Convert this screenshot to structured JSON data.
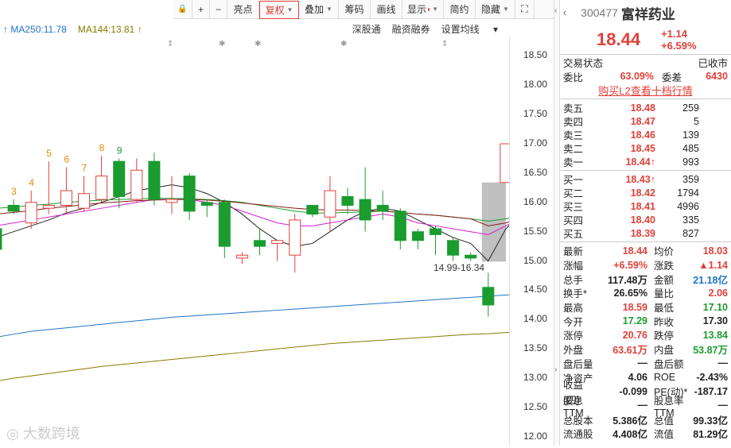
{
  "toolbar": {
    "items": [
      {
        "label": "",
        "icon": "lock-icon"
      },
      {
        "label": "+"
      },
      {
        "label": "−"
      },
      {
        "label": "亮点"
      },
      {
        "label": "复权",
        "dropdown": true,
        "active": true
      },
      {
        "label": "叠加",
        "dropdown": true
      },
      {
        "label": "筹码"
      },
      {
        "label": "画线"
      },
      {
        "label": "显示",
        "dropdown": true,
        "dot": true
      },
      {
        "label": "简约"
      },
      {
        "label": "隐藏",
        "dropdown": true
      },
      {
        "label": "",
        "icon": "fullscreen-icon"
      }
    ]
  },
  "ma": [
    {
      "label": "MA250:11.78",
      "color": "#1f74c7"
    },
    {
      "label": "MA144:13.81",
      "color": "#8a7a00"
    }
  ],
  "chart_links": [
    "深股通",
    "融资融券",
    "设置均线"
  ],
  "chart": {
    "ytick_labels": [
      "18.50",
      "18.00",
      "17.50",
      "17.00",
      "16.50",
      "16.00",
      "15.50",
      "15.00",
      "14.50",
      "14.00",
      "13.50",
      "13.00",
      "12.50",
      "12.00"
    ],
    "range_label": "14.99-16.34",
    "seq_labels": [
      "3",
      "4",
      "5",
      "6",
      "7",
      "8",
      "9"
    ],
    "colors": {
      "up": "#e0413a",
      "down": "#1b9c2f"
    }
  },
  "chart_data": {
    "type": "candlestick",
    "ylim": [
      11.85,
      18.83
    ],
    "candles": [
      {
        "o": 15.55,
        "h": 15.9,
        "l": 15.05,
        "c": 15.2
      },
      {
        "o": 15.95,
        "h": 16.05,
        "l": 15.8,
        "c": 15.85
      },
      {
        "o": 15.65,
        "h": 16.2,
        "l": 15.55,
        "c": 16.0
      },
      {
        "o": 15.9,
        "h": 16.7,
        "l": 15.8,
        "c": 15.95
      },
      {
        "o": 15.95,
        "h": 16.6,
        "l": 15.8,
        "c": 16.2
      },
      {
        "o": 15.9,
        "h": 16.45,
        "l": 15.85,
        "c": 16.15
      },
      {
        "o": 16.05,
        "h": 16.8,
        "l": 16.0,
        "c": 16.45
      },
      {
        "o": 16.7,
        "h": 16.75,
        "l": 15.9,
        "c": 16.1
      },
      {
        "o": 16.05,
        "h": 16.75,
        "l": 16.0,
        "c": 16.55
      },
      {
        "o": 16.7,
        "h": 16.85,
        "l": 15.95,
        "c": 16.05
      },
      {
        "o": 16.0,
        "h": 16.45,
        "l": 15.8,
        "c": 16.05
      },
      {
        "o": 16.45,
        "h": 16.5,
        "l": 15.7,
        "c": 15.85
      },
      {
        "o": 16.0,
        "h": 16.05,
        "l": 15.75,
        "c": 15.95
      },
      {
        "o": 16.0,
        "h": 16.05,
        "l": 15.05,
        "c": 15.25
      },
      {
        "o": 15.05,
        "h": 15.15,
        "l": 14.95,
        "c": 15.1
      },
      {
        "o": 15.35,
        "h": 15.55,
        "l": 15.1,
        "c": 15.25
      },
      {
        "o": 15.3,
        "h": 15.35,
        "l": 15.0,
        "c": 15.35
      },
      {
        "o": 15.1,
        "h": 15.8,
        "l": 14.8,
        "c": 15.7
      },
      {
        "o": 15.95,
        "h": 15.95,
        "l": 15.75,
        "c": 15.8
      },
      {
        "o": 15.75,
        "h": 16.45,
        "l": 15.5,
        "c": 16.2
      },
      {
        "o": 16.1,
        "h": 16.25,
        "l": 15.8,
        "c": 15.95
      },
      {
        "o": 16.05,
        "h": 16.6,
        "l": 15.5,
        "c": 15.7
      },
      {
        "o": 15.95,
        "h": 16.2,
        "l": 15.7,
        "c": 15.85
      },
      {
        "o": 15.85,
        "h": 15.9,
        "l": 15.2,
        "c": 15.35
      },
      {
        "o": 15.5,
        "h": 15.55,
        "l": 15.2,
        "c": 15.35
      },
      {
        "o": 15.55,
        "h": 15.6,
        "l": 15.1,
        "c": 15.45
      },
      {
        "o": 15.35,
        "h": 15.4,
        "l": 15.0,
        "c": 15.1
      },
      {
        "o": 15.1,
        "h": 15.15,
        "l": 15.0,
        "c": 15.05
      },
      {
        "o": 14.55,
        "h": 14.8,
        "l": 14.05,
        "c": 14.25
      },
      {
        "o": 16.34,
        "h": 17.0,
        "l": 16.34,
        "c": 17.0
      },
      {
        "o": 17.0,
        "h": 17.45,
        "l": 16.9,
        "c": 17.35
      },
      {
        "o": 17.3,
        "h": 18.59,
        "l": 17.1,
        "c": 18.44
      }
    ],
    "ma_lines": [
      {
        "color": "#222",
        "values": [
          15.4,
          15.5,
          15.6,
          15.7,
          15.82,
          15.9,
          16.0,
          16.1,
          16.2,
          16.25,
          16.3,
          16.25,
          16.15,
          16.0,
          15.8,
          15.55,
          15.35,
          15.25,
          15.3,
          15.5,
          15.7,
          15.85,
          15.9,
          15.85,
          15.7,
          15.55,
          15.4,
          15.3,
          15.0,
          15.55,
          15.85,
          16.3
        ]
      },
      {
        "color": "#d020d0",
        "values": [
          15.6,
          15.65,
          15.7,
          15.75,
          15.8,
          15.85,
          15.9,
          15.95,
          16.0,
          16.05,
          16.05,
          16.05,
          16.0,
          15.95,
          15.85,
          15.75,
          15.65,
          15.6,
          15.6,
          15.65,
          15.7,
          15.75,
          15.8,
          15.75,
          15.65,
          15.6,
          15.55,
          15.5,
          15.45,
          15.6,
          15.75,
          15.9
        ]
      },
      {
        "color": "#1b9c2f",
        "values": [
          15.9,
          15.92,
          15.95,
          15.97,
          16.0,
          16.02,
          16.04,
          16.05,
          16.06,
          16.07,
          16.07,
          16.06,
          16.05,
          16.03,
          16.0,
          15.95,
          15.9,
          15.85,
          15.82,
          15.82,
          15.83,
          15.84,
          15.85,
          15.83,
          15.8,
          15.78,
          15.75,
          15.72,
          15.68,
          15.72,
          15.8,
          15.92
        ]
      },
      {
        "color": "#8b1a1a",
        "values": [
          15.8,
          15.83,
          15.86,
          15.9,
          15.93,
          15.96,
          15.99,
          16.01,
          16.03,
          16.04,
          16.05,
          16.05,
          16.04,
          16.02,
          15.99,
          15.96,
          15.93,
          15.9,
          15.88,
          15.87,
          15.87,
          15.86,
          15.85,
          15.83,
          15.8,
          15.78,
          15.75,
          15.72,
          15.6,
          15.65,
          15.75,
          15.86
        ]
      },
      {
        "color": "#1f74c7",
        "values": [
          13.7,
          13.75,
          13.8,
          13.83,
          13.86,
          13.89,
          13.92,
          13.95,
          13.98,
          14.01,
          14.04,
          14.06,
          14.08,
          14.1,
          14.12,
          14.14,
          14.16,
          14.18,
          14.2,
          14.22,
          14.24,
          14.26,
          14.28,
          14.3,
          14.32,
          14.34,
          14.36,
          14.38,
          14.4,
          14.42,
          14.44,
          14.5
        ]
      },
      {
        "color": "#8a7a00",
        "values": [
          12.95,
          13.0,
          13.04,
          13.08,
          13.12,
          13.16,
          13.2,
          13.23,
          13.26,
          13.29,
          13.32,
          13.35,
          13.38,
          13.41,
          13.44,
          13.47,
          13.5,
          13.53,
          13.56,
          13.59,
          13.61,
          13.63,
          13.65,
          13.67,
          13.69,
          13.71,
          13.73,
          13.75,
          13.76,
          13.78,
          13.8,
          13.84
        ]
      }
    ]
  },
  "quote": {
    "code": "300477",
    "name": "富祥药业",
    "price": "18.44",
    "change": "+1.14",
    "change_pct": "+6.59%",
    "status_label": "交易状态",
    "status_value": "已收市",
    "wb_label": "委比",
    "wb_value": "63.09%",
    "wc_label": "委差",
    "wc_value": "6430",
    "buy_l2": "购买L2查看十档行情"
  },
  "asks": [
    {
      "label": "卖五",
      "price": "18.48",
      "vol": "259"
    },
    {
      "label": "卖四",
      "price": "18.47",
      "vol": "5"
    },
    {
      "label": "卖三",
      "price": "18.46",
      "vol": "139"
    },
    {
      "label": "卖二",
      "price": "18.45",
      "vol": "485"
    },
    {
      "label": "卖一",
      "price": "18.44↑",
      "vol": "993"
    }
  ],
  "bids": [
    {
      "label": "买一",
      "price": "18.43↑",
      "vol": "359"
    },
    {
      "label": "买二",
      "price": "18.42",
      "vol": "1794"
    },
    {
      "label": "买三",
      "price": "18.41",
      "vol": "4996"
    },
    {
      "label": "买四",
      "price": "18.40",
      "vol": "335"
    },
    {
      "label": "买五",
      "price": "18.39",
      "vol": "827"
    }
  ],
  "stats": [
    {
      "k1": "最新",
      "v1": "18.44",
      "c1": "red",
      "k2": "均价",
      "v2": "18.03",
      "c2": "red"
    },
    {
      "k1": "涨幅",
      "v1": "+6.59%",
      "c1": "red",
      "k2": "涨跌",
      "v2": "▲1.14",
      "c2": "red"
    },
    {
      "k1": "总手",
      "v1": "117.48万",
      "c1": "",
      "k2": "金额",
      "v2": "21.18亿",
      "c2": "blue"
    },
    {
      "k1": "换手*",
      "v1": "26.65%",
      "c1": "",
      "k2": "量比",
      "v2": "2.06",
      "c2": "red"
    },
    {
      "k1": "最高",
      "v1": "18.59",
      "c1": "red",
      "k2": "最低",
      "v2": "17.10",
      "c2": "green"
    },
    {
      "k1": "今开",
      "v1": "17.29",
      "c1": "green",
      "k2": "昨收",
      "v2": "17.30",
      "c2": ""
    },
    {
      "k1": "涨停",
      "v1": "20.76",
      "c1": "red",
      "k2": "跌停",
      "v2": "13.84",
      "c2": "green"
    },
    {
      "k1": "外盘",
      "v1": "63.61万",
      "c1": "red",
      "k2": "内盘",
      "v2": "53.87万",
      "c2": "green"
    },
    {
      "k1": "盘后量",
      "v1": "—",
      "c1": "",
      "k2": "盘后额",
      "v2": "—",
      "c2": ""
    },
    {
      "k1": "净资产",
      "v1": "4.06",
      "c1": "",
      "k2": "ROE",
      "v2": "-2.43%",
      "c2": ""
    },
    {
      "k1": "收益(四)",
      "v1": "-0.099",
      "c1": "",
      "k2": "PE(动)*",
      "v2": "-187.17",
      "c2": ""
    },
    {
      "k1": "股息TTM",
      "v1": "—",
      "c1": "",
      "k2": "股息率TTM",
      "v2": "—",
      "c2": ""
    },
    {
      "k1": "总股本",
      "v1": "5.386亿",
      "c1": "",
      "k2": "总值",
      "v2": "99.33亿",
      "c2": ""
    },
    {
      "k1": "流通股",
      "v1": "4.408亿",
      "c1": "",
      "k2": "流值",
      "v2": "81.29亿",
      "c2": ""
    }
  ],
  "watermark": "大数跨境"
}
